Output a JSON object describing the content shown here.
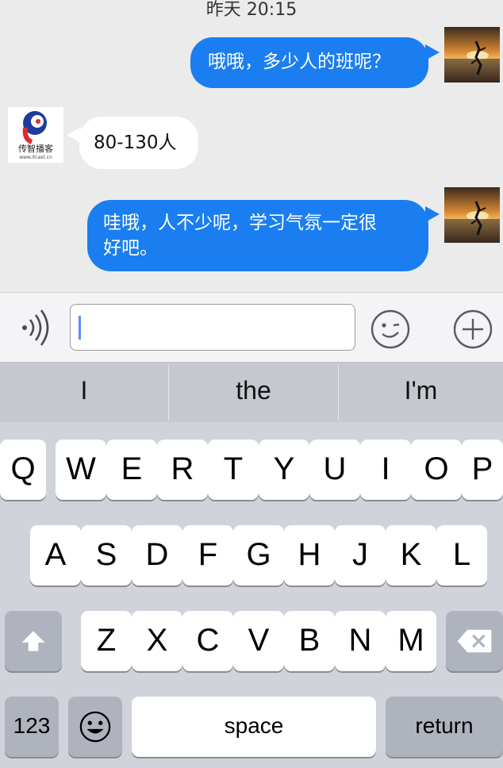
{
  "chat": {
    "timestamp": "昨天 20:15",
    "messages": [
      {
        "direction": "out",
        "text": "哦哦，多少人的班呢？"
      },
      {
        "direction": "in",
        "text": "80-130人"
      },
      {
        "direction": "out",
        "lines": [
          "哇哦，人不少呢，学习气氛一定很",
          "好吧。"
        ]
      }
    ],
    "org_avatar_text": "传智播客",
    "org_avatar_url_text": "www.itcast.cn"
  },
  "input_bar": {
    "input_value": "",
    "icons": [
      "voice-icon",
      "emoji-icon",
      "plus-icon"
    ]
  },
  "keyboard": {
    "suggestions": [
      "I",
      "the",
      "I'm"
    ],
    "rows": [
      [
        "Q",
        "W",
        "E",
        "R",
        "T",
        "Y",
        "U",
        "I",
        "O",
        "P"
      ],
      [
        "A",
        "S",
        "D",
        "F",
        "G",
        "H",
        "J",
        "K",
        "L"
      ],
      [
        "Z",
        "X",
        "C",
        "V",
        "B",
        "N",
        "M"
      ]
    ],
    "numbers_label": "123",
    "space_label": "space",
    "return_label": "return",
    "icons": [
      "shift-icon",
      "backspace-icon",
      "emoji-icon"
    ]
  },
  "colors": {
    "bubble_out": "#1a7ef0",
    "bubble_in": "#ffffff",
    "chat_bg": "#ebebeb",
    "keyboard_bg": "#d0d3d9"
  }
}
